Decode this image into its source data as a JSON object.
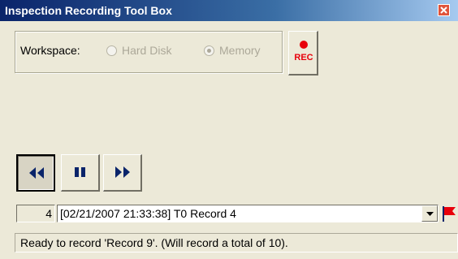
{
  "window": {
    "title": "Inspection Recording Tool Box",
    "close_icon": "close-icon"
  },
  "workspace": {
    "label": "Workspace:",
    "options": [
      {
        "label": "Hard Disk",
        "selected": false,
        "enabled": false
      },
      {
        "label": "Memory",
        "selected": true,
        "enabled": false
      }
    ]
  },
  "record_button": {
    "label": "REC",
    "icon": "record-icon",
    "color": "#E8000B"
  },
  "transport": [
    {
      "name": "rewind",
      "icon": "rewind-icon",
      "pressed": true
    },
    {
      "name": "pause",
      "icon": "pause-icon",
      "pressed": false
    },
    {
      "name": "fast-forward",
      "icon": "fast-forward-icon",
      "pressed": false
    }
  ],
  "record_selector": {
    "index": "4",
    "selected_value": "[02/21/2007 21:33:38] T0 Record 4"
  },
  "flag_icon": "flag-icon",
  "status": {
    "text": "Ready to record 'Record 9'. (Will record a total of 10)."
  },
  "colors": {
    "title_gradient_start": "#0A246A",
    "title_gradient_end": "#A6CAF0",
    "transport_icon": "#0A246A",
    "face": "#ECE9D8"
  }
}
